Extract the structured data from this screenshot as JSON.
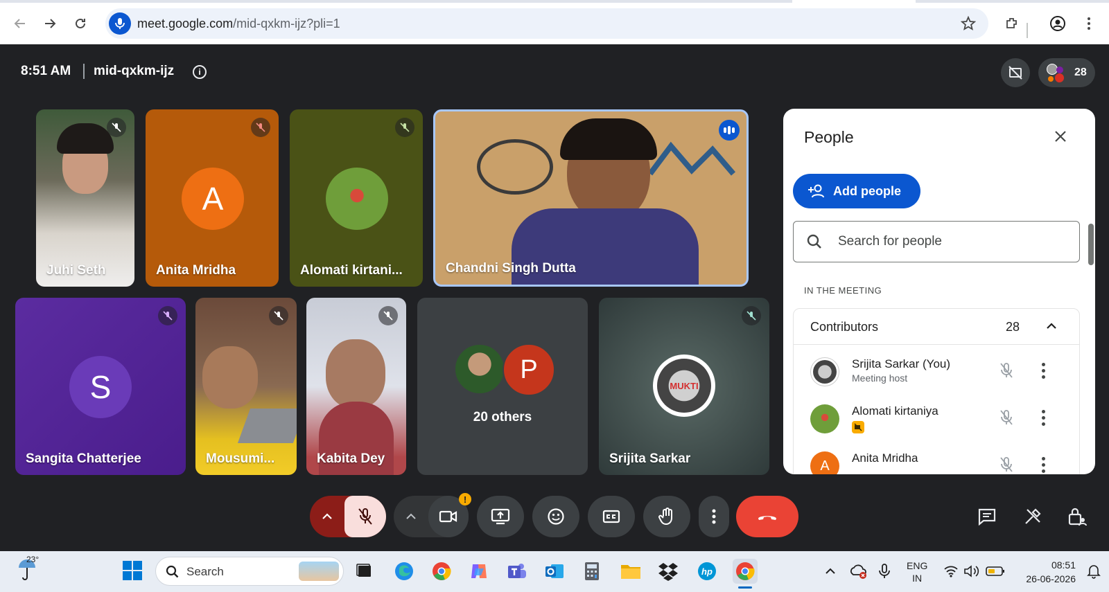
{
  "browser": {
    "url_host": "meet.google.com",
    "url_path": "/mid-qxkm-ijz?pli=1"
  },
  "meet": {
    "time": "8:51 AM",
    "meeting_code": "mid-qxkm-ijz",
    "participant_count": "28"
  },
  "tiles": [
    {
      "name": "Juhi Seth"
    },
    {
      "name": "Anita Mridha",
      "initial": "A"
    },
    {
      "name": "Alomati kirtani..."
    },
    {
      "name": "Chandni Singh Dutta"
    },
    {
      "name": "Sangita Chatterjee",
      "initial": "S"
    },
    {
      "name": "Mousumi..."
    },
    {
      "name": "Kabita Dey"
    },
    {
      "name": "20 others",
      "initial": "P"
    },
    {
      "name": "Srijita Sarkar"
    }
  ],
  "people_panel": {
    "title": "People",
    "add_button": "Add people",
    "search_placeholder": "Search for people",
    "section_label": "IN THE MEETING",
    "group_title": "Contributors",
    "group_count": "28",
    "people": [
      {
        "name": "Srijita Sarkar (You)",
        "subtitle": "Meeting host"
      },
      {
        "name": "Alomati kirtaniya",
        "subtitle": ""
      },
      {
        "name": "Anita Mridha",
        "subtitle": "",
        "initial": "A"
      }
    ]
  },
  "logo_text": "MUKTI",
  "taskbar": {
    "weather": "23°",
    "search_label": "Search",
    "lang_line1": "ENG",
    "lang_line2": "IN",
    "clock_time": "08:51",
    "clock_date": "26-06-2026"
  },
  "colors": {
    "meet_bg": "#202124",
    "accent_blue": "#0b57d0",
    "end_call_red": "#ea4335",
    "mic_off_pink": "#f9dedc"
  }
}
